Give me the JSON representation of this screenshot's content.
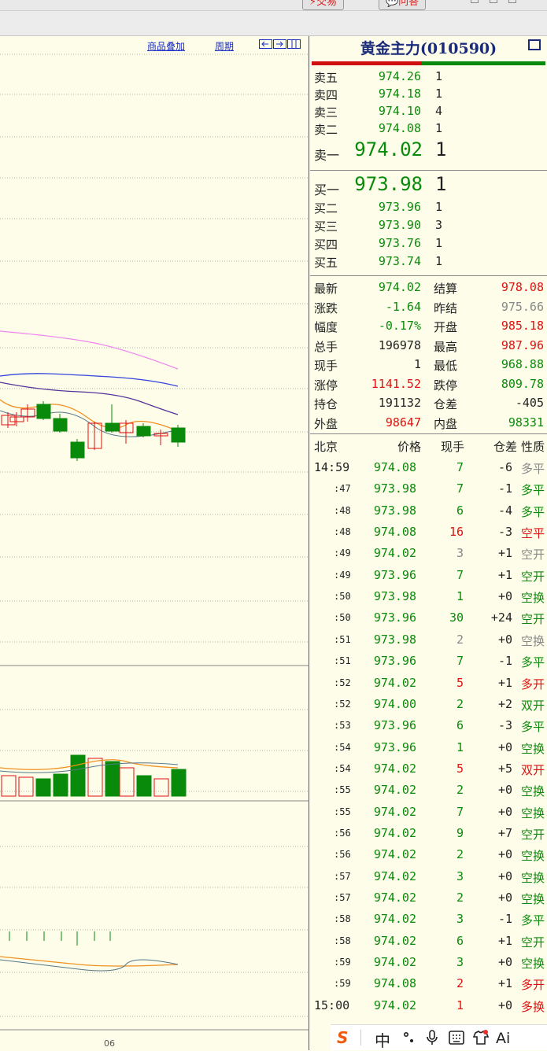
{
  "toolbar": {
    "trade_label": "⚡交易",
    "qa_label": "💬问答"
  },
  "chart": {
    "overlay_link": "商品叠加",
    "period_link": "周期",
    "x_tick": "06"
  },
  "panel": {
    "title": "黄金主力(010590)",
    "sell": [
      {
        "label": "卖五",
        "price": "974.26",
        "vol": "1"
      },
      {
        "label": "卖四",
        "price": "974.18",
        "vol": "1"
      },
      {
        "label": "卖三",
        "price": "974.10",
        "vol": "4"
      },
      {
        "label": "卖二",
        "price": "974.08",
        "vol": "1"
      },
      {
        "label": "卖一",
        "price": "974.02",
        "vol": "1"
      }
    ],
    "buy": [
      {
        "label": "买一",
        "price": "973.98",
        "vol": "1"
      },
      {
        "label": "买二",
        "price": "973.96",
        "vol": "1"
      },
      {
        "label": "买三",
        "price": "973.90",
        "vol": "3"
      },
      {
        "label": "买四",
        "price": "973.76",
        "vol": "1"
      },
      {
        "label": "买五",
        "price": "973.74",
        "vol": "1"
      }
    ],
    "stats": [
      {
        "l1": "最新",
        "v1": "974.02",
        "c1": "g",
        "l2": "结算",
        "v2": "978.08",
        "c2": "r"
      },
      {
        "l1": "涨跌",
        "v1": "-1.64",
        "c1": "g",
        "l2": "昨结",
        "v2": "975.66",
        "c2": "gr"
      },
      {
        "l1": "幅度",
        "v1": "-0.17%",
        "c1": "g",
        "l2": "开盘",
        "v2": "985.18",
        "c2": "r"
      },
      {
        "l1": "总手",
        "v1": "196978",
        "c1": "k",
        "l2": "最高",
        "v2": "987.96",
        "c2": "r"
      },
      {
        "l1": "现手",
        "v1": "1",
        "c1": "k",
        "l2": "最低",
        "v2": "968.88",
        "c2": "g"
      },
      {
        "l1": "涨停",
        "v1": "1141.52",
        "c1": "r",
        "l2": "跌停",
        "v2": "809.78",
        "c2": "g"
      },
      {
        "l1": "持仓",
        "v1": "191132",
        "c1": "k",
        "l2": "仓差",
        "v2": "-405",
        "c2": "k"
      },
      {
        "l1": "外盘",
        "v1": "98647",
        "c1": "r",
        "l2": "内盘",
        "v2": "98331",
        "c2": "g"
      }
    ],
    "tick_header": {
      "city": "北京",
      "price": "价格",
      "vol": "现手",
      "diff": "仓差",
      "nature": "性质"
    },
    "ticks": [
      {
        "t": "14:59",
        "p": "974.08",
        "v": "7",
        "vc": "g",
        "d": "-6",
        "n": "多平",
        "nc": "gr"
      },
      {
        "t": ":47",
        "p": "973.98",
        "v": "7",
        "vc": "g",
        "d": "-1",
        "n": "多平",
        "nc": "g"
      },
      {
        "t": ":48",
        "p": "973.98",
        "v": "6",
        "vc": "g",
        "d": "-4",
        "n": "多平",
        "nc": "g"
      },
      {
        "t": ":48",
        "p": "974.08",
        "v": "16",
        "vc": "r",
        "d": "-3",
        "n": "空平",
        "nc": "r"
      },
      {
        "t": ":49",
        "p": "974.02",
        "v": "3",
        "vc": "gr",
        "d": "+1",
        "n": "空开",
        "nc": "gr"
      },
      {
        "t": ":49",
        "p": "973.96",
        "v": "7",
        "vc": "g",
        "d": "+1",
        "n": "空开",
        "nc": "g"
      },
      {
        "t": ":50",
        "p": "973.98",
        "v": "1",
        "vc": "g",
        "d": "+0",
        "n": "空换",
        "nc": "g"
      },
      {
        "t": ":50",
        "p": "973.96",
        "v": "30",
        "vc": "g",
        "d": "+24",
        "n": "空开",
        "nc": "g"
      },
      {
        "t": ":51",
        "p": "973.98",
        "v": "2",
        "vc": "gr",
        "d": "+0",
        "n": "空换",
        "nc": "gr"
      },
      {
        "t": ":51",
        "p": "973.96",
        "v": "7",
        "vc": "g",
        "d": "-1",
        "n": "多平",
        "nc": "g"
      },
      {
        "t": ":52",
        "p": "974.02",
        "v": "5",
        "vc": "r",
        "d": "+1",
        "n": "多开",
        "nc": "r"
      },
      {
        "t": ":52",
        "p": "974.00",
        "v": "2",
        "vc": "g",
        "d": "+2",
        "n": "双开",
        "nc": "g"
      },
      {
        "t": ":53",
        "p": "973.96",
        "v": "6",
        "vc": "g",
        "d": "-3",
        "n": "多平",
        "nc": "g"
      },
      {
        "t": ":54",
        "p": "973.96",
        "v": "1",
        "vc": "g",
        "d": "+0",
        "n": "空换",
        "nc": "g"
      },
      {
        "t": ":54",
        "p": "974.02",
        "v": "5",
        "vc": "r",
        "d": "+5",
        "n": "双开",
        "nc": "r"
      },
      {
        "t": ":55",
        "p": "974.02",
        "v": "2",
        "vc": "g",
        "d": "+0",
        "n": "空换",
        "nc": "g"
      },
      {
        "t": ":55",
        "p": "974.02",
        "v": "7",
        "vc": "g",
        "d": "+0",
        "n": "空换",
        "nc": "g"
      },
      {
        "t": ":56",
        "p": "974.02",
        "v": "9",
        "vc": "g",
        "d": "+7",
        "n": "空开",
        "nc": "g"
      },
      {
        "t": ":56",
        "p": "974.02",
        "v": "2",
        "vc": "g",
        "d": "+0",
        "n": "空换",
        "nc": "g"
      },
      {
        "t": ":57",
        "p": "974.02",
        "v": "3",
        "vc": "g",
        "d": "+0",
        "n": "空换",
        "nc": "g"
      },
      {
        "t": ":57",
        "p": "974.02",
        "v": "2",
        "vc": "g",
        "d": "+0",
        "n": "空换",
        "nc": "g"
      },
      {
        "t": ":58",
        "p": "974.02",
        "v": "3",
        "vc": "g",
        "d": "-1",
        "n": "多平",
        "nc": "g"
      },
      {
        "t": ":58",
        "p": "974.02",
        "v": "6",
        "vc": "g",
        "d": "+1",
        "n": "空开",
        "nc": "g"
      },
      {
        "t": ":59",
        "p": "974.02",
        "v": "3",
        "vc": "g",
        "d": "+0",
        "n": "空换",
        "nc": "g"
      },
      {
        "t": ":59",
        "p": "974.08",
        "v": "2",
        "vc": "r",
        "d": "+1",
        "n": "多开",
        "nc": "r"
      },
      {
        "t": "15:00",
        "p": "974.02",
        "v": "1",
        "vc": "r",
        "d": "+0",
        "n": "多换",
        "nc": "r"
      }
    ]
  },
  "ime": {
    "s_icon": "S",
    "zh": "中"
  },
  "colors": {
    "bg": "#fdfde9",
    "up": "#e01010",
    "down": "#0a8a0a",
    "ma_pink": "#ee88ee",
    "ma_blue": "#3344dd",
    "ma_purple": "#553399",
    "ma_orange": "#f09020"
  }
}
